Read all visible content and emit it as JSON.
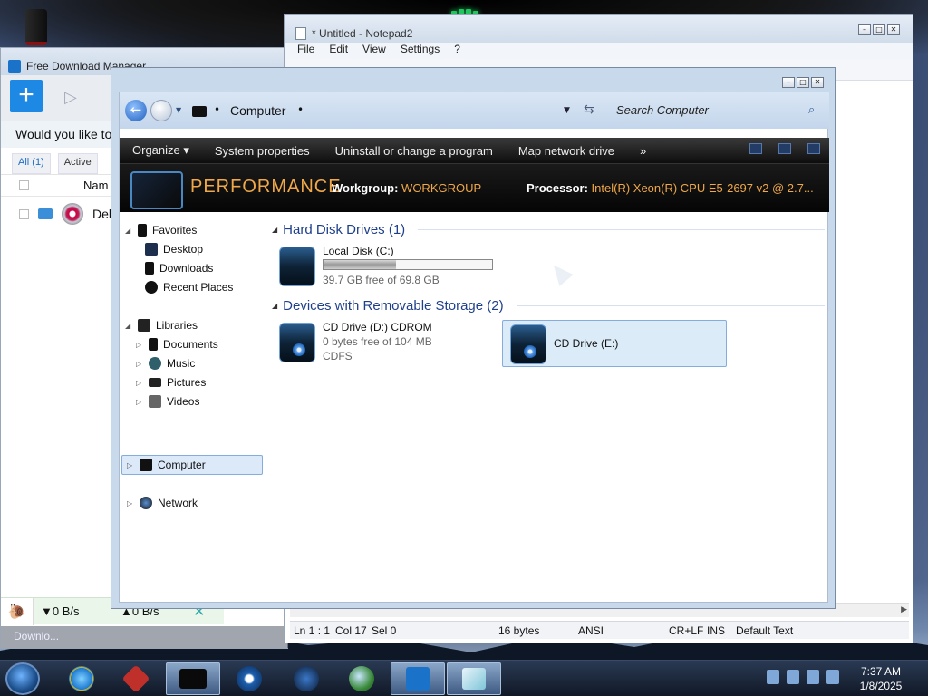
{
  "fdm": {
    "title": "Free Download Manager",
    "add_label": "+",
    "banner_text": "Would you like to",
    "tabs": [
      "All (1)",
      "Active"
    ],
    "col_name": "Nam",
    "row_name": "Deb",
    "down_speed": "▼0 B/s",
    "up_speed": "▲0 B/s",
    "footer": "Downlo..."
  },
  "notepad": {
    "title": "* Untitled - Notepad2",
    "menu": [
      "File",
      "Edit",
      "View",
      "Settings",
      "?"
    ],
    "status": {
      "position": "Ln 1 : 1",
      "col": "Col 17",
      "sel": "Sel 0",
      "size": "16 bytes",
      "encoding": "ANSI",
      "eol": "CR+LF",
      "ins": "INS",
      "scheme": "Default Text"
    }
  },
  "explorer": {
    "address": "Computer",
    "search_placeholder": "Search Computer",
    "commands": [
      "Organize ▾",
      "System properties",
      "Uninstall or change a program",
      "Map network drive",
      "»"
    ],
    "banner": {
      "title": "PERFORMANCE",
      "workgroup_label": "Workgroup:",
      "workgroup_value": "WORKGROUP",
      "processor_label": "Processor:",
      "processor_value": "Intel(R) Xeon(R) CPU E5-2697 v2 @ 2.7..."
    },
    "nav": {
      "favorites": "Favorites",
      "desktop": "Desktop",
      "downloads": "Downloads",
      "recent": "Recent Places",
      "libraries": "Libraries",
      "documents": "Documents",
      "music": "Music",
      "pictures": "Pictures",
      "videos": "Videos",
      "computer": "Computer",
      "network": "Network"
    },
    "groups": {
      "hdd": "Hard Disk Drives (1)",
      "removable": "Devices with Removable Storage (2)"
    },
    "drives": {
      "c_name": "Local Disk (C:)",
      "c_free": "39.7 GB free of 69.8 GB",
      "c_used_fraction": 0.43,
      "d_name": "CD Drive (D:) CDROM",
      "d_free": "0 bytes free of 104 MB",
      "d_fs": "CDFS",
      "e_name": "CD Drive (E:)"
    }
  },
  "taskbar": {
    "time": "7:37 AM",
    "date": "1/8/2025"
  },
  "colors": {
    "accent_orange": "#f0a848",
    "group_blue": "#1e3f8a",
    "fdm_blue": "#1e88e5"
  }
}
